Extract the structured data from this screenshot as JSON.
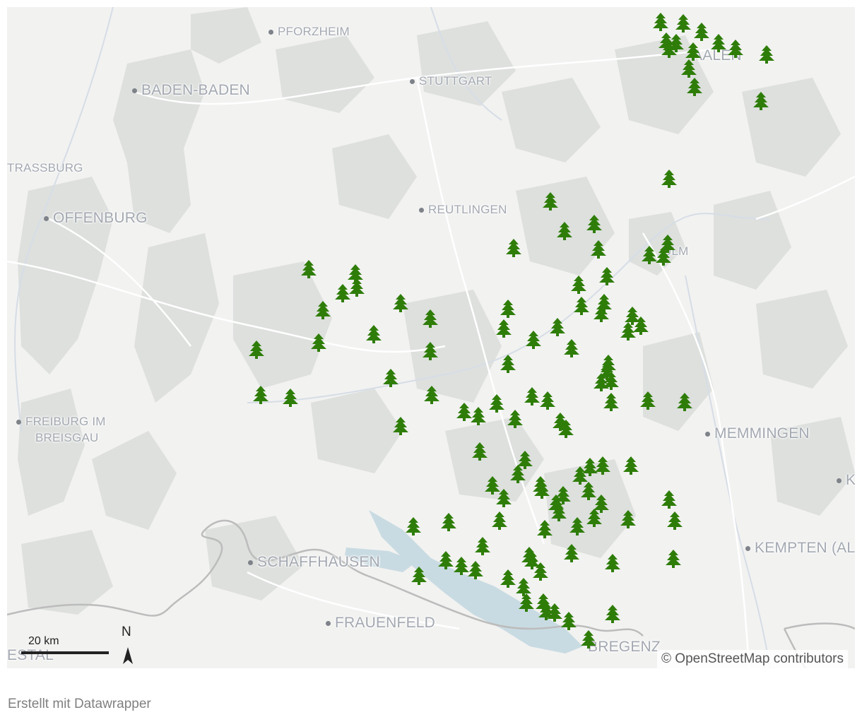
{
  "map": {
    "attribution": "© OpenStreetMap contributors",
    "scale_label": "20 km",
    "north_label": "N",
    "marker_icon": "tree-icon",
    "marker_color": "#2f7d09",
    "background_color": "#f2f2f1",
    "forest_color": "#dde0dd",
    "water_color": "#c9dbe2",
    "border_color": "#bcbcbc"
  },
  "cities": [
    {
      "name": "Pforzheim",
      "label": "PFORZHEIM",
      "size": "small"
    },
    {
      "name": "Baden-Baden",
      "label": "BADEN-BADEN",
      "size": "large"
    },
    {
      "name": "Stuttgart",
      "label": "STUTTGART",
      "size": "small"
    },
    {
      "name": "Aalen",
      "label": "AALEN",
      "size": "large"
    },
    {
      "name": "Strassburg",
      "label": "TRASSBURG",
      "size": "small"
    },
    {
      "name": "Offenburg",
      "label": "OFFENBURG",
      "size": "large"
    },
    {
      "name": "Reutlingen",
      "label": "REUTLINGEN",
      "size": "small"
    },
    {
      "name": "Ulm",
      "label": "ULM",
      "size": "small"
    },
    {
      "name": "Freiburg",
      "label": "FREIBURG IM",
      "size": "small"
    },
    {
      "name": "Freiburg-2",
      "label": "BREISGAU",
      "size": "small"
    },
    {
      "name": "Memmingen",
      "label": "MEMMINGEN",
      "size": "large"
    },
    {
      "name": "Kempten",
      "label": "KEMPTEN (AL",
      "size": "large"
    },
    {
      "name": "Schaffhausen",
      "label": "SCHAFFHAUSEN",
      "size": "large"
    },
    {
      "name": "Frauenfeld",
      "label": "FRAUENFELD",
      "size": "large"
    },
    {
      "name": "Bregenz",
      "label": "BREGENZ",
      "size": "large"
    },
    {
      "name": "Estal",
      "label": "ESTAL",
      "size": "large"
    },
    {
      "name": "K-edge",
      "label": "K",
      "size": "large"
    }
  ],
  "footer": {
    "credit": "Erstellt mit Datawrapper"
  }
}
